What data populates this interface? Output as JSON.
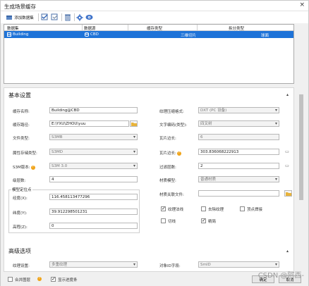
{
  "window": {
    "title": "生成场景缓存",
    "close": "×"
  },
  "toolbar": {
    "add_label": "添加数据集"
  },
  "grid": {
    "headers": [
      "数据集",
      "数据源",
      "缓存类型",
      "拆分类型"
    ],
    "row": {
      "dataset": "Building",
      "datasource": "CBD",
      "cache_type": "三维切片",
      "split_type": "球面"
    }
  },
  "basic": {
    "title": "基本设置",
    "cache_name_label": "缓存名称:",
    "cache_name": "Building@CBD",
    "cache_path_label": "缓存路径:",
    "cache_path": "E:\\YXU\\ZHOU\\yuu",
    "file_type_label": "文件类型:",
    "file_type": "S3MB",
    "attr_type_label": "属性存储类型:",
    "attr_type": "S3MD",
    "s3m_version_label": "S3M版本:",
    "s3m_version": "S3M 3.0",
    "level_label": "级层数:",
    "level": "4",
    "origin_group": "模型定位点",
    "lon_label": "经度(X):",
    "lon": "116.458113477296",
    "lat_label": "纬度(Y):",
    "lat": "39.912298501231",
    "alt_label": "高程(Z):",
    "alt": "0",
    "texture_compress_label": "纹理压缩格式:",
    "texture_compress": "DXT (PC 设备)",
    "char_encoding_label": "文字编码(类型):",
    "char_encoding": "四叉树",
    "tile_side_label": "瓦片边长:",
    "tile_side": "6",
    "tile_size_label": "瓦片边长:",
    "tile_size": "303.836068222913",
    "filter_label": "过滤层数:",
    "filter": "2",
    "material_label": "材质模型:",
    "material": "普通材质",
    "material_file_label": "材质关联文件:",
    "material_file": "",
    "checks": [
      {
        "label": "纹理法线",
        "on": true
      },
      {
        "label": "去除纹理",
        "on": false
      },
      {
        "label": "顶点焊接",
        "on": false
      },
      {
        "label": "切线",
        "on": false
      },
      {
        "label": "精简",
        "on": true
      }
    ]
  },
  "advanced": {
    "title": "高级选项",
    "texture_label": "纹理设置:",
    "texture": "多重纹理",
    "id_field_label": "对象ID字段:",
    "id_field": "SmID"
  },
  "footer": {
    "merge_label": "合并图层",
    "progress_label": "显示进度条",
    "ok": "确定",
    "cancel": "取消"
  },
  "watermark": "CSDN @阿西-",
  "colors": {
    "selection": "#1e73d8",
    "help_icon": "#f0a41a"
  }
}
